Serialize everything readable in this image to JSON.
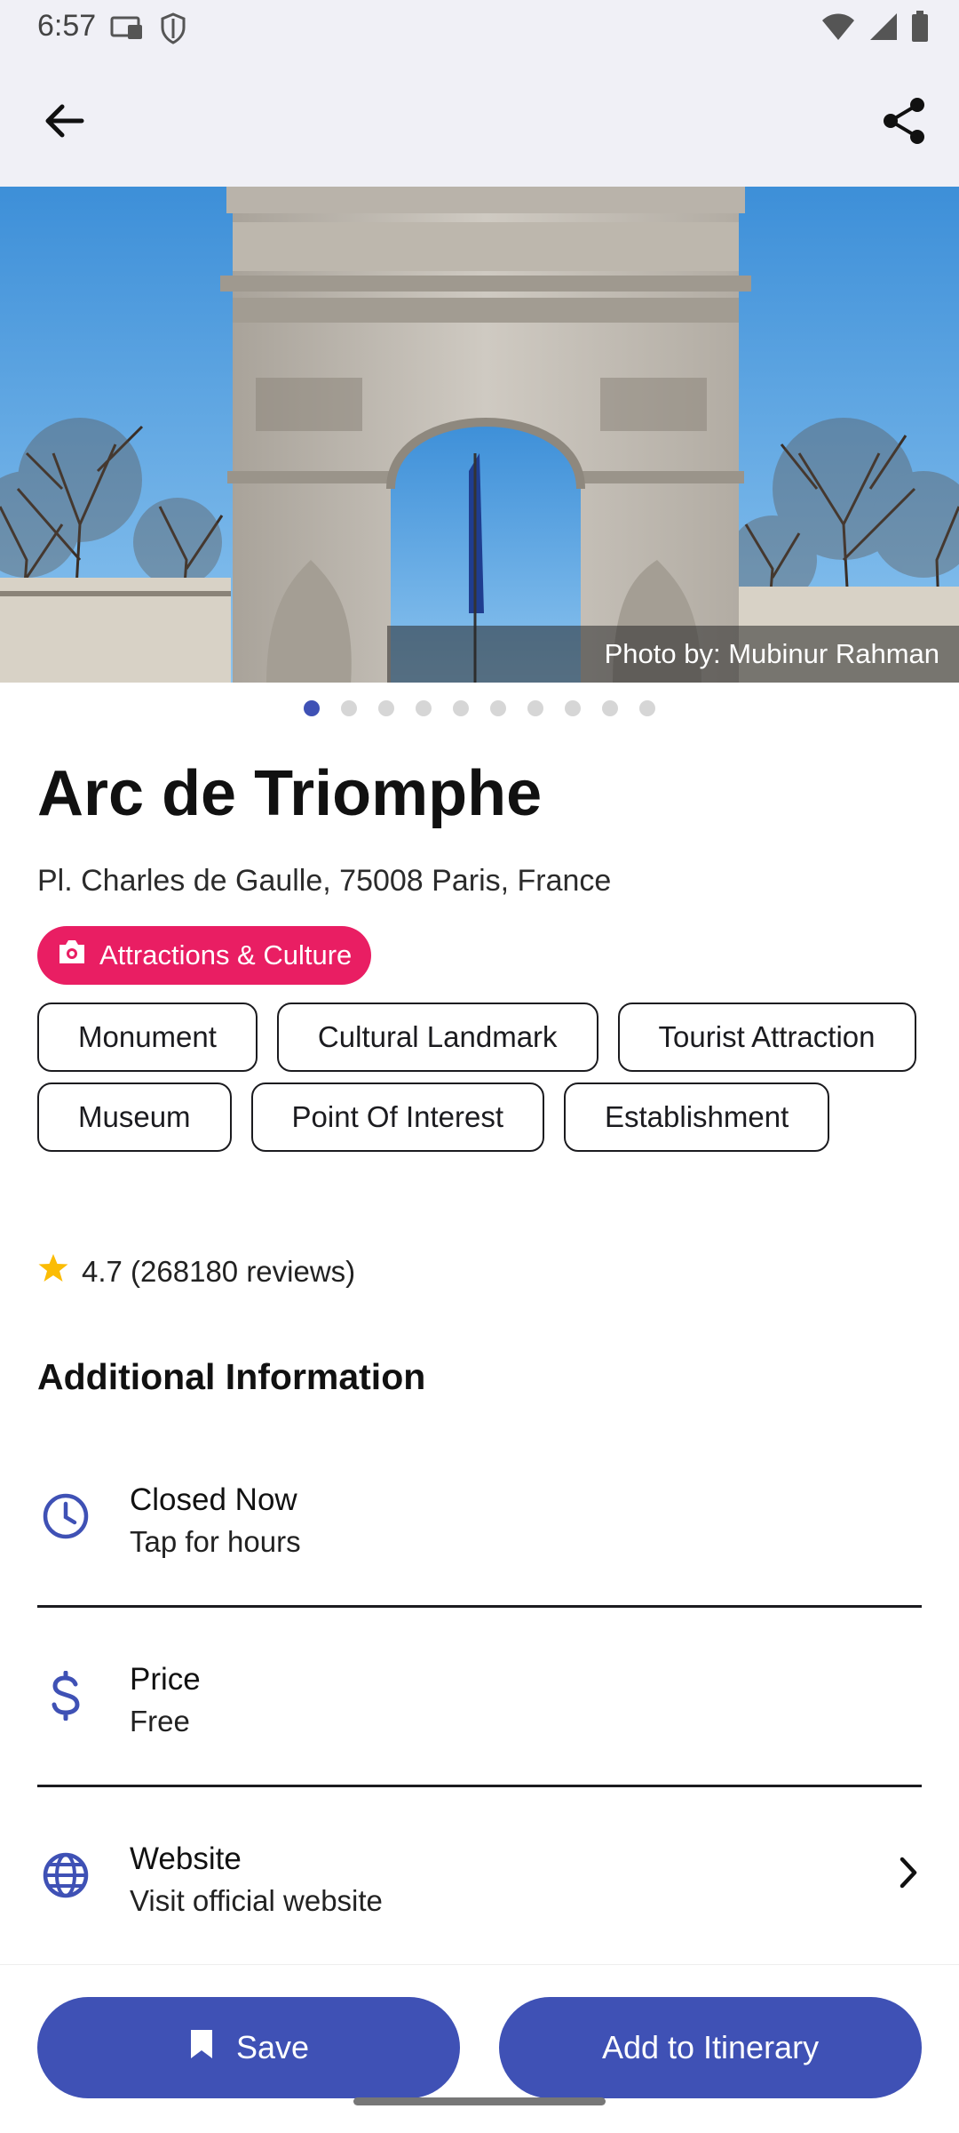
{
  "status_bar": {
    "time": "6:57",
    "icons": [
      "cast-icon",
      "shield-icon",
      "wifi-icon",
      "signal-icon",
      "battery-icon"
    ]
  },
  "app_bar": {
    "back_icon": "arrow-back-icon",
    "share_icon": "share-icon"
  },
  "hero": {
    "photo_credit": "Photo by: Mubinur Rahman",
    "image_count": 10,
    "active_index": 0
  },
  "place": {
    "name": "Arc de Triomphe",
    "address": "Pl. Charles de Gaulle, 75008 Paris, France",
    "category": "Attractions & Culture",
    "category_color": "#e91e63",
    "tags": [
      "Monument",
      "Cultural Landmark",
      "Tourist Attraction",
      "Museum",
      "Point Of Interest",
      "Establishment"
    ],
    "rating": "4.7 (268180 reviews)",
    "star_color": "#fbbc04"
  },
  "additional": {
    "title": "Additional Information",
    "rows": [
      {
        "label": "Closed Now",
        "sub": "Tap for hours",
        "icon": "clock-icon"
      },
      {
        "label": "Price",
        "sub": "Free",
        "icon": "dollar-icon"
      },
      {
        "label": "Website",
        "sub": "Visit official website",
        "icon": "globe-icon"
      }
    ]
  },
  "actions": {
    "save_label": "Save",
    "itinerary_label": "Add to Itinerary",
    "accent": "#3f51b5"
  }
}
